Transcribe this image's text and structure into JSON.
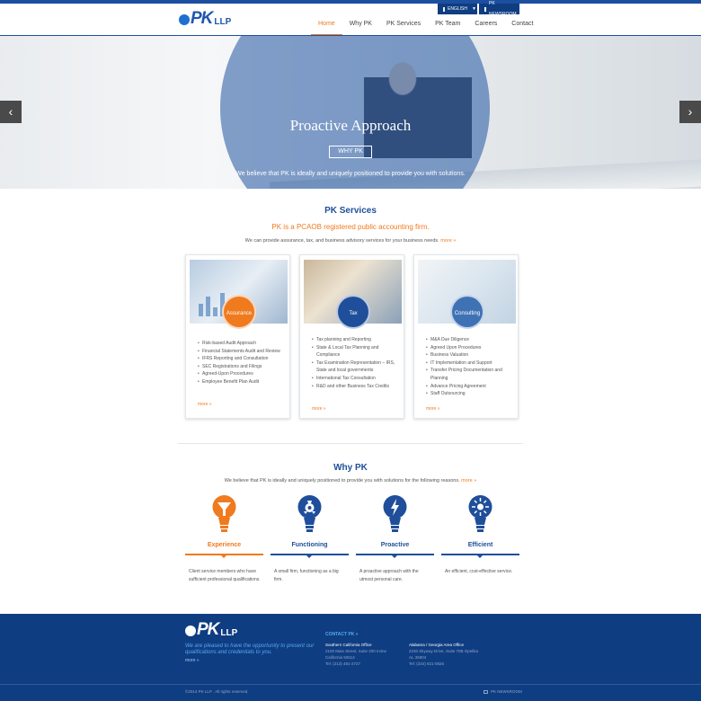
{
  "colors": {
    "brand_blue": "#1f4f9a",
    "accent_orange": "#f07a1e",
    "footer_bg": "#0f3d82"
  },
  "utility": {
    "language": "ENGLISH",
    "newsroom": "PK NEWSROOM"
  },
  "logo": {
    "mark": "PK",
    "suffix": "LLP"
  },
  "nav": {
    "items": [
      "Home",
      "Why PK",
      "PK Services",
      "PK Team",
      "Careers",
      "Contact"
    ],
    "active": "Home"
  },
  "hero": {
    "title": "Proactive Approach",
    "button": "WHY PK",
    "subtitle": "We believe that PK is ideally and uniquely positioned to provide you with solutions.",
    "prev_icon": "chevron-left-icon",
    "next_icon": "chevron-right-icon"
  },
  "services": {
    "title": "PK Services",
    "tagline": "PK is a PCAOB registered public accounting firm.",
    "intro": "We can provide assurance, tax, and business advisory services for your business needs.",
    "intro_more": "more »",
    "cards": [
      {
        "name": "Assurance",
        "items": [
          "Risk-based Audit Approach",
          "Financial Statements Audit and Review",
          "IFRS Reporting and Consultation",
          "SEC Registrations and Filings",
          "Agreed-Upon Procedures",
          "Employee Benefit Plan Audit"
        ],
        "more": "more »"
      },
      {
        "name": "Tax",
        "items": [
          "Tax planning and Reporting",
          "State & Local Tax Planning and Compliance",
          "Tax Examination Representation – IRS, State and local governments",
          "International Tax Consultation",
          "R&D and other Business Tax Credits"
        ],
        "more": "more »"
      },
      {
        "name": "Consulting",
        "items": [
          "M&A Due Diligence",
          "Agreed Upon Procedures",
          "Business Valuation",
          "IT Implementation and Support",
          "Transfer Pricing Documentation and Planning",
          "Advance Pricing Agreement",
          "Staff Outsourcing"
        ],
        "more": "more »"
      }
    ]
  },
  "why": {
    "title": "Why PK",
    "intro": "We believe that PK is ideally and uniquely positioned to provide you with solutions for the following reasons.",
    "intro_more": "more »",
    "features": [
      {
        "label": "Experience",
        "text": "Client service members who have sufficient professional qualifications.",
        "icon": "filter-bulb-icon"
      },
      {
        "label": "Functioning",
        "text": "A small firm, functioning as a big firm.",
        "icon": "gear-bulb-icon"
      },
      {
        "label": "Proactive",
        "text": "A proactive approach with the utmost personal care.",
        "icon": "lightning-bulb-icon"
      },
      {
        "label": "Efficient",
        "text": "An efficient, cost-effective service.",
        "icon": "spark-bulb-icon"
      }
    ]
  },
  "footer": {
    "tagline": "We are pleased to have the opportunity to present our qualifications and credentials to you.",
    "more": "more »",
    "contact_heading": "CONTACT PK »",
    "offices": [
      {
        "name": "Southern California Office",
        "line1": "2100 Main Street, Suite 200 Irvine",
        "line2": "California 92614",
        "phone": "Tel: (213) 481-2727"
      },
      {
        "name": "Alabama / Georgia Area Office",
        "line1": "2230 Skyway Drive, Suite 70B Opelika",
        "line2": "AL 36804",
        "phone": "Tel: (334) 821-0826"
      }
    ],
    "copyright": "©2014 PK LLP . All rights reserved.",
    "newsroom": "PK NEWSROOM"
  }
}
